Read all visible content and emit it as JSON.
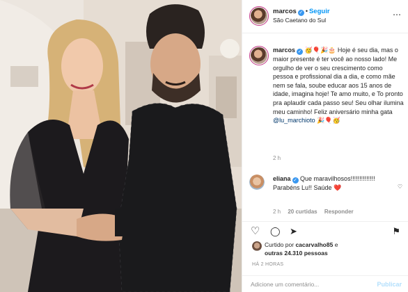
{
  "header": {
    "username": "marcos",
    "follow_label": "Seguir",
    "location": "São Caetano do Sul",
    "dot": "•",
    "more_icon": "⋯"
  },
  "caption": {
    "username": "marcos",
    "emoji_lead": "🥳🎈🎉🎂",
    "body": "Hoje é seu dia, mas o maior presente é ter você ao nosso lado! Me orgulho de ver o seu crescimento como pessoa e profissional dia a dia, e como mãe nem se fala, soube educar aos 15 anos de idade, imagina hoje! Te amo muito, e To pronto pra aplaudir cada passo seu! Seu olhar ilumina meu caminho! Feliz aniversário minha gata",
    "mention": "@lu_marchioto",
    "emoji_tail": "🎉🎈🥳",
    "time": "2 h"
  },
  "comment": {
    "username": "eliana",
    "text": "Que maravilhosos!!!!!!!!!!!!!! Parabéns Lu!! Saúde ❤️",
    "time": "2 h",
    "likes": "20 curtidas",
    "reply": "Responder",
    "heart_icon": "♡"
  },
  "actions": {
    "like_icon": "♡",
    "comment_icon": "◯",
    "share_icon": "➤",
    "save_icon": "⚑"
  },
  "likes": {
    "prefix": "Curtido por",
    "user": "cacarvalho85",
    "middle": "e",
    "others": "outras 24.310 pessoas"
  },
  "posted_time": "HÁ 2 HORAS",
  "add_comment": {
    "placeholder": "Adicione um comentário...",
    "publish": "Publicar"
  },
  "colors": {
    "link_blue": "#0095f6",
    "verified_blue": "#3897f0",
    "mention_blue": "#00376b",
    "muted": "#8e8e8e"
  }
}
